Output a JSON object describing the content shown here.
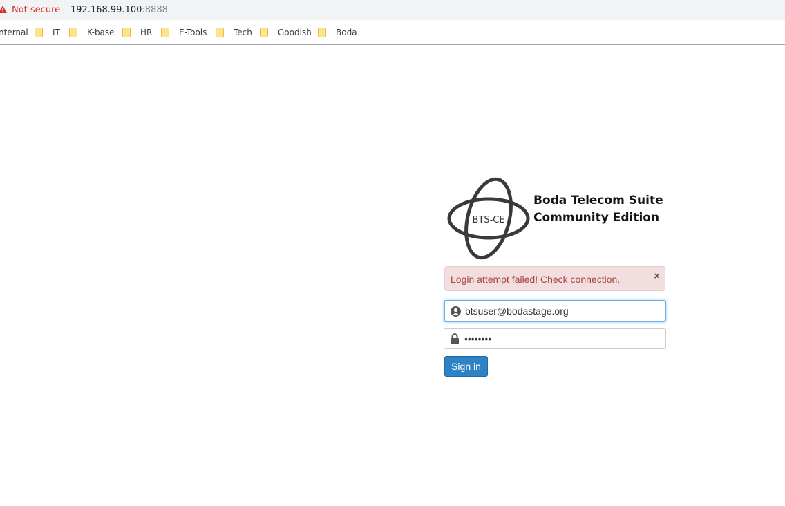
{
  "address_bar": {
    "security_label": "Not secure",
    "url_host": "192.168.99.100",
    "url_port": ":8888"
  },
  "bookmarks": [
    {
      "label": "nternal",
      "has_folder": false
    },
    {
      "label": "IT",
      "has_folder": true
    },
    {
      "label": "K-base",
      "has_folder": true
    },
    {
      "label": "HR",
      "has_folder": true
    },
    {
      "label": "E-Tools",
      "has_folder": true
    },
    {
      "label": "Tech",
      "has_folder": true
    },
    {
      "label": "Goodish",
      "has_folder": true
    },
    {
      "label": "Boda",
      "has_folder": true
    }
  ],
  "login": {
    "logo_text": "BTS-CE",
    "brand_line_1": "Boda Telecom Suite",
    "brand_line_2": "Community Edition",
    "alert_message": "Login attempt failed! Check connection.",
    "alert_close": "×",
    "email_value": "btsuser@bodastage.org",
    "password_value": "password",
    "signin_label": "Sign in"
  },
  "colors": {
    "not_secure": "#d93025",
    "alert_bg": "#f2dede",
    "alert_text": "#a94442",
    "primary_button": "#2d83c6",
    "focus_border": "#66afe9"
  },
  "icons": {
    "warning": "warning-triangle-icon",
    "folder": "folder-icon",
    "user": "user-icon",
    "lock": "lock-icon",
    "close": "close-icon"
  }
}
